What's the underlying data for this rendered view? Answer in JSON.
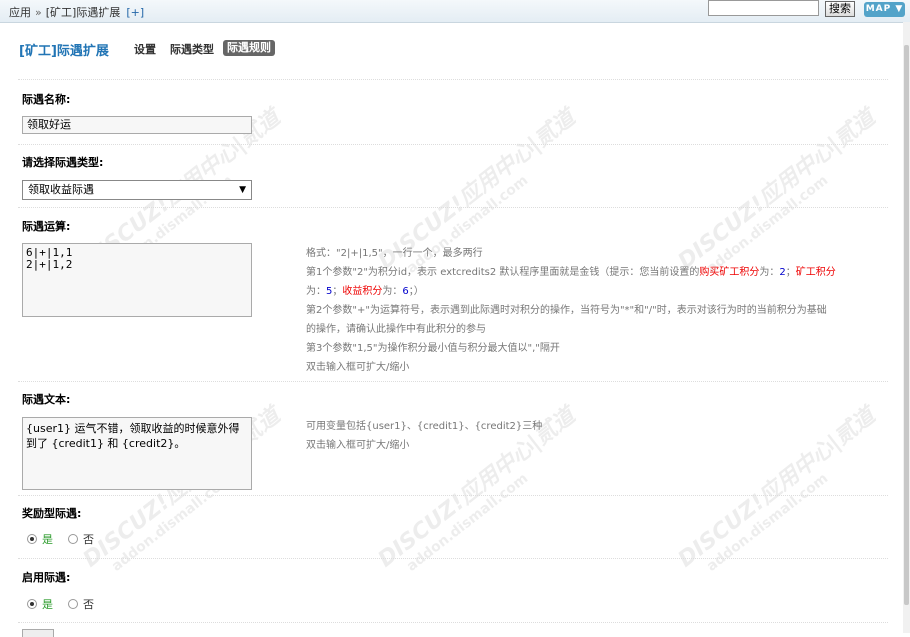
{
  "breadcrumb": {
    "root": "应用",
    "sep": "»",
    "current": "[矿工]际遇扩展",
    "plus": "[+]"
  },
  "search": {
    "button": "搜索",
    "value": ""
  },
  "map_button": "MAP",
  "header": {
    "plugin_title": "[矿工]际遇扩展",
    "tabs": [
      "设置",
      "际遇类型",
      "际遇规则"
    ]
  },
  "form": {
    "name": {
      "label": "际遇名称:",
      "value": "领取好运"
    },
    "type": {
      "label": "请选择际遇类型:",
      "selected": "领取收益际遇"
    },
    "calc": {
      "label": "际遇运算:",
      "value": "6|+|1,1\n2|+|1,2",
      "tip": {
        "l1": "格式：\"2|+|1,5\"，一行一个，最多两行",
        "l2_pre": "第1个参数\"2\"为积分id，表示 extcredits2 默认程序里面就是金钱（提示：您当前设置的",
        "l2_red1": "购买矿工积分",
        "l2_mid1": "为：",
        "l2_blue1": "2",
        "l2_mid2": "；",
        "l2_red2": "矿工积分",
        "l3_pre": "为：",
        "l3_blue1": "5",
        "l3_mid1": "；",
        "l3_red1": "收益积分",
        "l3_mid2": "为：",
        "l3_blue2": "6",
        "l3_end": "；）",
        "l4": "第2个参数\"+\"为运算符号，表示遇到此际遇时对积分的操作，当符号为\"*\"和\"/\"时，表示对该行为时的当前积分为基础",
        "l5": "的操作，请确认此操作中有此积分的参与",
        "l6": "第3个参数\"1,5\"为操作积分最小值与积分最大值以\",\"隔开",
        "l7": "双击输入框可扩大/缩小"
      }
    },
    "text": {
      "label": "际遇文本:",
      "value": "{user1} 运气不错，领取收益的时候意外得到了 {credit1} 和 {credit2}。",
      "tip1": "可用变量包括{user1}、{credit1}、{credit2}三种",
      "tip2": "双击输入框可扩大/缩小"
    },
    "reward": {
      "label": "奖励型际遇:",
      "yes": "是",
      "no": "否"
    },
    "enable": {
      "label": "启用际遇:",
      "yes": "是",
      "no": "否"
    }
  },
  "watermark": {
    "brand": "DISCUZ!应用中心|贰道",
    "url": "addon.dismall.com"
  }
}
